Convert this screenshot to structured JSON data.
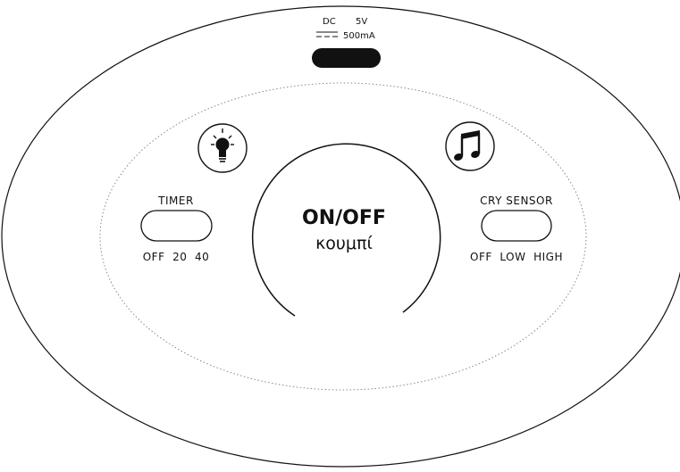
{
  "power_port": {
    "line1_left": "DC",
    "line1_right": "5V",
    "line2_right": "500mA"
  },
  "main_button": {
    "title": "ON/OFF",
    "subtitle": "κουμπί"
  },
  "timer": {
    "label": "TIMER",
    "options": "OFF  20  40"
  },
  "cry_sensor": {
    "label": "CRY SENSOR",
    "options": "OFF  LOW  HIGH"
  },
  "icons": {
    "left": "light-bulb-icon",
    "right": "music-note-icon"
  },
  "colors": {
    "stroke": "#111111",
    "background": "#ffffff",
    "dotted": "#888888"
  }
}
